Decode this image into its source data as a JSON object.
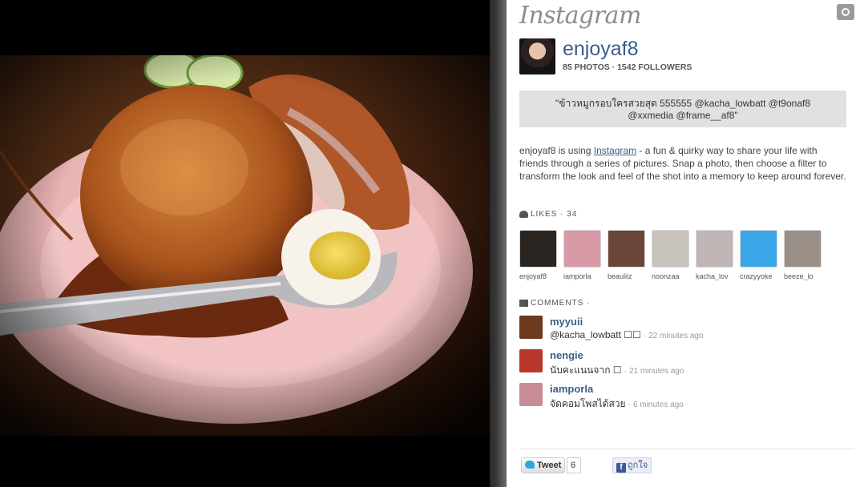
{
  "brand": {
    "logo_text": "Instagram",
    "camera_icon": "camera-icon"
  },
  "profile": {
    "username": "enjoyaf8",
    "stats": "85 PHOTOS · 1542 FOLLOWERS"
  },
  "caption": "\"ข้าวหมูกรอบใครสวยสุด 555555 @kacha_lowbatt @t9onaf8 @xxmedia @frame__af8\"",
  "about": {
    "prefix": "enjoyaf8 is using ",
    "link": "Instagram",
    "suffix": " - a fun & quirky way to share your life with friends through a series of pictures. Snap a photo, then choose a filter to transform the look and feel of the shot into a memory to keep around forever."
  },
  "likes": {
    "label": "LIKES",
    "count": "· 34",
    "users": [
      {
        "name": "enjoyaf8",
        "color": "#2b2522"
      },
      {
        "name": "iamporla",
        "color": "#d99aa8"
      },
      {
        "name": "beauliiz",
        "color": "#6a4436"
      },
      {
        "name": "noonzaa",
        "color": "#c7c2bb"
      },
      {
        "name": "kacha_lov",
        "color": "#bfb5b5"
      },
      {
        "name": "crazyyoke",
        "color": "#3aa8e8"
      },
      {
        "name": "beeze_lo",
        "color": "#9a8f86"
      }
    ]
  },
  "comments": {
    "label": "COMMENTS",
    "sep": "·",
    "items": [
      {
        "user": "myyuii",
        "text": "@kacha_lowbatt ☐☐",
        "ago": "· 22 minutes ago",
        "color": "#6b3a1f"
      },
      {
        "user": "nengie",
        "text": "นับคะแนนจาก ☐",
        "ago": "· 21 minutes ago",
        "color": "#b8382c"
      },
      {
        "user": "iamporla",
        "text": "จัดคอมโพสได้สวย",
        "ago": "· 6 minutes ago",
        "color": "#c78c97"
      }
    ]
  },
  "share": {
    "tweet_label": "Tweet",
    "tweet_count": "6",
    "fb_label": "ถูกใจ"
  }
}
